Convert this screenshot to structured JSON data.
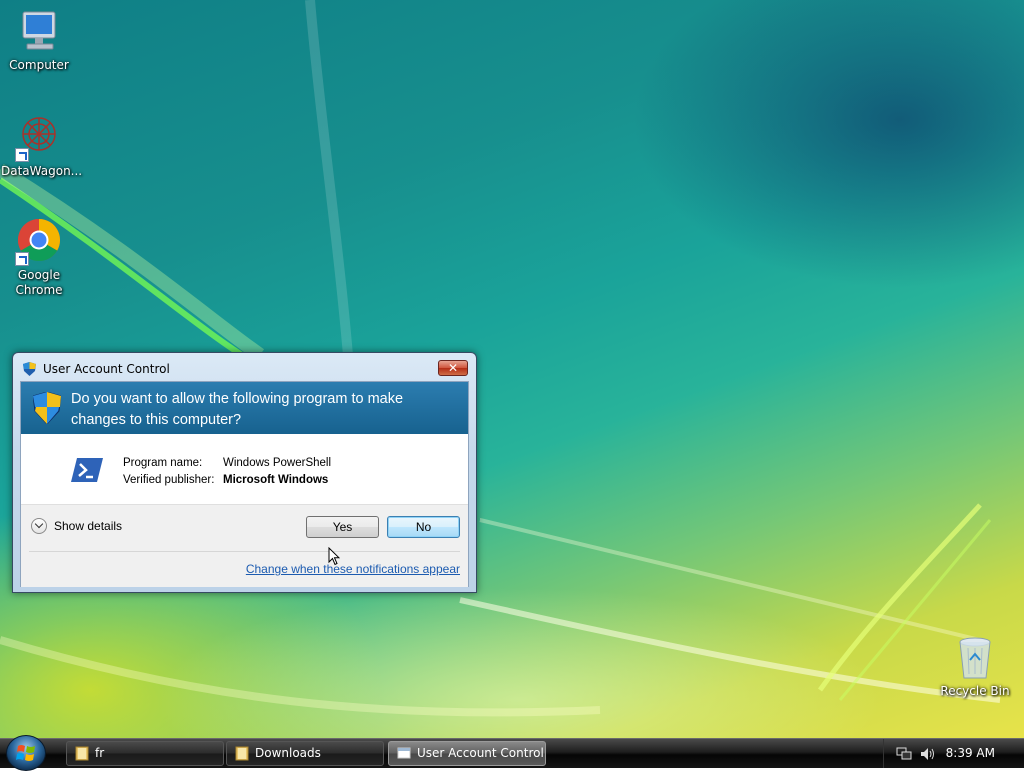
{
  "desktop": {
    "icons": [
      {
        "label": "Computer"
      },
      {
        "label": "DataWagon..."
      },
      {
        "label": "Google Chrome"
      },
      {
        "label": "Recycle Bin"
      }
    ]
  },
  "uac_dialog": {
    "title": "User Account Control",
    "close_label": "✕",
    "question": "Do you want to allow the following program to make changes to this computer?",
    "program_name_label": "Program name:",
    "program_name": "Windows PowerShell",
    "publisher_label": "Verified publisher:",
    "publisher": "Microsoft Windows",
    "show_details": "Show details",
    "yes_label": "Yes",
    "no_label": "No",
    "change_link": "Change when these notifications appear"
  },
  "taskbar": {
    "tasks": [
      {
        "label": "fr"
      },
      {
        "label": "Downloads"
      },
      {
        "label": "User Account Control"
      }
    ],
    "clock": "8:39 AM"
  }
}
